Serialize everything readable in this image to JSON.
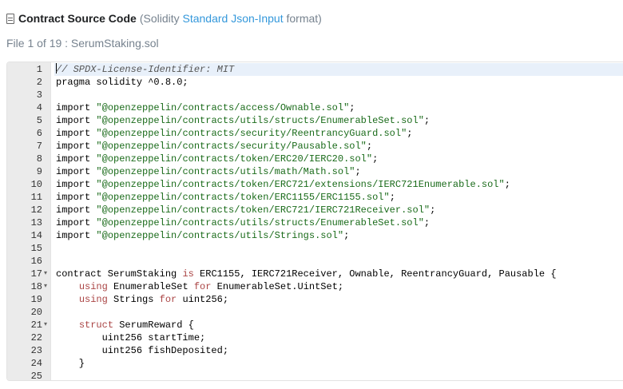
{
  "header": {
    "icon": "document-code-icon",
    "title": "Contract Source Code",
    "meta_open": "(Solidity",
    "meta_link": "Standard Json-Input",
    "meta_close": "format)"
  },
  "file_info": "File 1 of 19 : SerumStaking.sol",
  "editor": {
    "active_line": 1,
    "lines": [
      {
        "n": "1",
        "fold": false,
        "tokens": [
          [
            "comment",
            "// SPDX-License-Identifier: MIT"
          ]
        ]
      },
      {
        "n": "2",
        "fold": false,
        "tokens": [
          [
            "plain",
            "pragma solidity ^0.8.0;"
          ]
        ]
      },
      {
        "n": "3",
        "fold": false,
        "tokens": []
      },
      {
        "n": "4",
        "fold": false,
        "tokens": [
          [
            "plain",
            "import "
          ],
          [
            "string",
            "\"@openzeppelin/contracts/access/Ownable.sol\""
          ],
          [
            "plain",
            ";"
          ]
        ]
      },
      {
        "n": "5",
        "fold": false,
        "tokens": [
          [
            "plain",
            "import "
          ],
          [
            "string",
            "\"@openzeppelin/contracts/utils/structs/EnumerableSet.sol\""
          ],
          [
            "plain",
            ";"
          ]
        ]
      },
      {
        "n": "6",
        "fold": false,
        "tokens": [
          [
            "plain",
            "import "
          ],
          [
            "string",
            "\"@openzeppelin/contracts/security/ReentrancyGuard.sol\""
          ],
          [
            "plain",
            ";"
          ]
        ]
      },
      {
        "n": "7",
        "fold": false,
        "tokens": [
          [
            "plain",
            "import "
          ],
          [
            "string",
            "\"@openzeppelin/contracts/security/Pausable.sol\""
          ],
          [
            "plain",
            ";"
          ]
        ]
      },
      {
        "n": "8",
        "fold": false,
        "tokens": [
          [
            "plain",
            "import "
          ],
          [
            "string",
            "\"@openzeppelin/contracts/token/ERC20/IERC20.sol\""
          ],
          [
            "plain",
            ";"
          ]
        ]
      },
      {
        "n": "9",
        "fold": false,
        "tokens": [
          [
            "plain",
            "import "
          ],
          [
            "string",
            "\"@openzeppelin/contracts/utils/math/Math.sol\""
          ],
          [
            "plain",
            ";"
          ]
        ]
      },
      {
        "n": "10",
        "fold": false,
        "tokens": [
          [
            "plain",
            "import "
          ],
          [
            "string",
            "\"@openzeppelin/contracts/token/ERC721/extensions/IERC721Enumerable.sol\""
          ],
          [
            "plain",
            ";"
          ]
        ]
      },
      {
        "n": "11",
        "fold": false,
        "tokens": [
          [
            "plain",
            "import "
          ],
          [
            "string",
            "\"@openzeppelin/contracts/token/ERC1155/ERC1155.sol\""
          ],
          [
            "plain",
            ";"
          ]
        ]
      },
      {
        "n": "12",
        "fold": false,
        "tokens": [
          [
            "plain",
            "import "
          ],
          [
            "string",
            "\"@openzeppelin/contracts/token/ERC721/IERC721Receiver.sol\""
          ],
          [
            "plain",
            ";"
          ]
        ]
      },
      {
        "n": "13",
        "fold": false,
        "tokens": [
          [
            "plain",
            "import "
          ],
          [
            "string",
            "\"@openzeppelin/contracts/utils/structs/EnumerableSet.sol\""
          ],
          [
            "plain",
            ";"
          ]
        ]
      },
      {
        "n": "14",
        "fold": false,
        "tokens": [
          [
            "plain",
            "import "
          ],
          [
            "string",
            "\"@openzeppelin/contracts/utils/Strings.sol\""
          ],
          [
            "plain",
            ";"
          ]
        ]
      },
      {
        "n": "15",
        "fold": false,
        "tokens": []
      },
      {
        "n": "16",
        "fold": false,
        "tokens": []
      },
      {
        "n": "17",
        "fold": true,
        "tokens": [
          [
            "plain",
            "contract SerumStaking "
          ],
          [
            "kw2",
            "is"
          ],
          [
            "plain",
            " ERC1155, IERC721Receiver, Ownable, ReentrancyGuard, Pausable {"
          ]
        ]
      },
      {
        "n": "18",
        "fold": true,
        "tokens": [
          [
            "plain",
            "    "
          ],
          [
            "kw2",
            "using"
          ],
          [
            "plain",
            " EnumerableSet "
          ],
          [
            "kw2",
            "for"
          ],
          [
            "plain",
            " EnumerableSet.UintSet;"
          ]
        ]
      },
      {
        "n": "19",
        "fold": false,
        "tokens": [
          [
            "plain",
            "    "
          ],
          [
            "kw2",
            "using"
          ],
          [
            "plain",
            " Strings "
          ],
          [
            "kw2",
            "for"
          ],
          [
            "plain",
            " uint256;"
          ]
        ]
      },
      {
        "n": "20",
        "fold": false,
        "tokens": []
      },
      {
        "n": "21",
        "fold": true,
        "tokens": [
          [
            "plain",
            "    "
          ],
          [
            "kw2",
            "struct"
          ],
          [
            "plain",
            " SerumReward {"
          ]
        ]
      },
      {
        "n": "22",
        "fold": false,
        "tokens": [
          [
            "plain",
            "        uint256 startTime;"
          ]
        ]
      },
      {
        "n": "23",
        "fold": false,
        "tokens": [
          [
            "plain",
            "        uint256 fishDeposited;"
          ]
        ]
      },
      {
        "n": "24",
        "fold": false,
        "tokens": [
          [
            "plain",
            "    }"
          ]
        ]
      },
      {
        "n": "25",
        "fold": false,
        "tokens": []
      }
    ]
  }
}
